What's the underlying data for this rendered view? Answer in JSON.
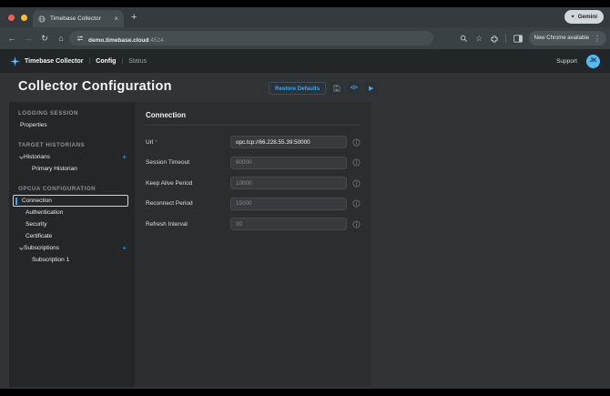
{
  "browser": {
    "tab_title": "Timebase Collector",
    "tab_close": "×",
    "new_tab": "+",
    "gemini": {
      "icon": "✦",
      "label": "Gemini"
    },
    "back": "←",
    "forward": "→",
    "reload": "↻",
    "home": "⌂",
    "url_host": "demo.timebase.cloud",
    "url_port": ":4524",
    "bookmark_star": "☆",
    "menu_dots": "⋮",
    "new_chrome_label": "New Chrome available"
  },
  "app_header": {
    "brand": "Timebase Collector",
    "separator": "|",
    "nav_config": "Config",
    "nav_status": "Status",
    "support": "Support",
    "avatar_initials": "JK"
  },
  "page": {
    "title": "Collector Configuration",
    "restore_defaults": "Restore Defaults",
    "code_glyph": "</>",
    "play_glyph": "▶"
  },
  "sidebar": {
    "add_glyph": "+",
    "sections": [
      {
        "header": "LOGGING SESSION",
        "items": [
          {
            "label": "Properties",
            "indent": 12
          }
        ]
      },
      {
        "header": "TARGET HISTORIANS",
        "items": [
          {
            "label": "Historians",
            "indent": 11,
            "chevron": true,
            "add": true
          },
          {
            "label": "Primary Historian",
            "indent": 25
          }
        ]
      },
      {
        "header": "OPCUA CONFIGURATION",
        "items": [
          {
            "label": "Connection",
            "selected": true
          },
          {
            "label": "Authentication",
            "indent": 18
          },
          {
            "label": "Security",
            "indent": 18
          },
          {
            "label": "Certificate",
            "indent": 18
          },
          {
            "label": "Subscriptions",
            "indent": 11,
            "chevron": true,
            "add": true
          },
          {
            "label": "Subscription 1",
            "indent": 25
          }
        ]
      }
    ]
  },
  "panel": {
    "title": "Connection",
    "required_mark": "*",
    "fields": [
      {
        "label": "Url",
        "required": true,
        "value": "opc.tcp://66.228.55.39:50000",
        "primary": true
      },
      {
        "label": "Session Timeout",
        "value": "60000"
      },
      {
        "label": "Keep Alive Period",
        "value": "10000"
      },
      {
        "label": "Reconnect Period",
        "value": "15000"
      },
      {
        "label": "Refresh Interval",
        "value": "30"
      }
    ]
  },
  "colors": {
    "accent_blue": "#3fa3ef",
    "required_red": "#e05252",
    "avatar_blue": "#55b9ee",
    "page_bg": "#323335",
    "sidebar_bg": "#242628",
    "panel_bg": "#2c2d2f"
  }
}
